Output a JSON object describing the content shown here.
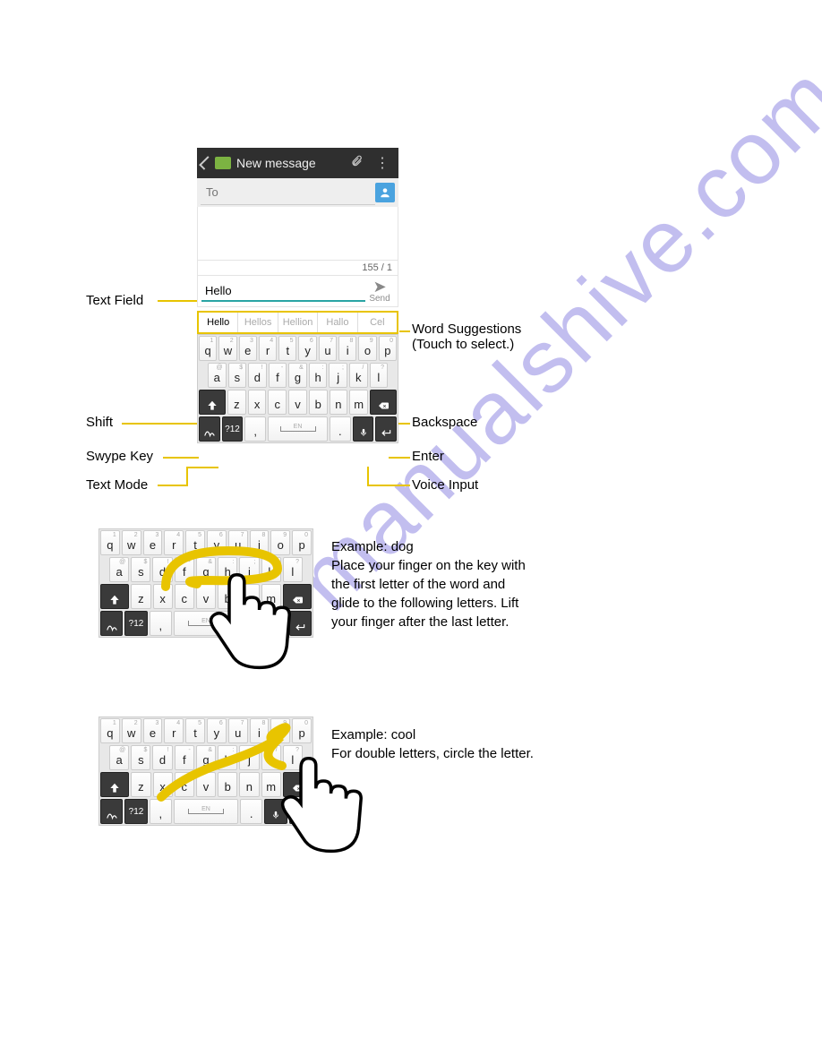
{
  "watermark": "manualshive.com",
  "section1": {
    "appbar": {
      "title": "New message"
    },
    "to_placeholder": "To",
    "charcount": "155 / 1",
    "compose_value": "Hello",
    "send_label": "Send",
    "suggestions": [
      "Hello",
      "Hellos",
      "Hellion",
      "Hallo",
      "Cel"
    ],
    "labels": {
      "text_field": "Text Field",
      "word_suggestions_l1": "Word Suggestions",
      "word_suggestions_l2": "(Touch to select.)",
      "shift": "Shift",
      "swype_key": "Swype Key",
      "text_mode": "Text Mode",
      "backspace": "Backspace",
      "enter": "Enter",
      "voice": "Voice Input"
    },
    "kbd": {
      "row1": [
        {
          "k": "q",
          "m": "1"
        },
        {
          "k": "w",
          "m": "2"
        },
        {
          "k": "e",
          "m": "3"
        },
        {
          "k": "r",
          "m": "4"
        },
        {
          "k": "t",
          "m": "5"
        },
        {
          "k": "y",
          "m": "6"
        },
        {
          "k": "u",
          "m": "7"
        },
        {
          "k": "i",
          "m": "8"
        },
        {
          "k": "o",
          "m": "9"
        },
        {
          "k": "p",
          "m": "0"
        }
      ],
      "row2": [
        {
          "k": "a",
          "m": "@"
        },
        {
          "k": "s",
          "m": "$"
        },
        {
          "k": "d",
          "m": "!"
        },
        {
          "k": "f",
          "m": "-"
        },
        {
          "k": "g",
          "m": "&"
        },
        {
          "k": "h",
          "m": ":"
        },
        {
          "k": "j",
          "m": ";"
        },
        {
          "k": "k",
          "m": "/"
        },
        {
          "k": "l",
          "m": "?"
        }
      ],
      "row3_mid": [
        "z",
        "x",
        "c",
        "v",
        "b",
        "n",
        "m"
      ],
      "num_label": "?12",
      "en_label": "EN"
    }
  },
  "example1": {
    "title": "Example: dog",
    "body": "Place your finger on the key with the first letter of the word and glide to the following letters. Lift your finger after the last letter."
  },
  "example2": {
    "title": "Example: cool",
    "body": "For double letters, circle the letter."
  }
}
